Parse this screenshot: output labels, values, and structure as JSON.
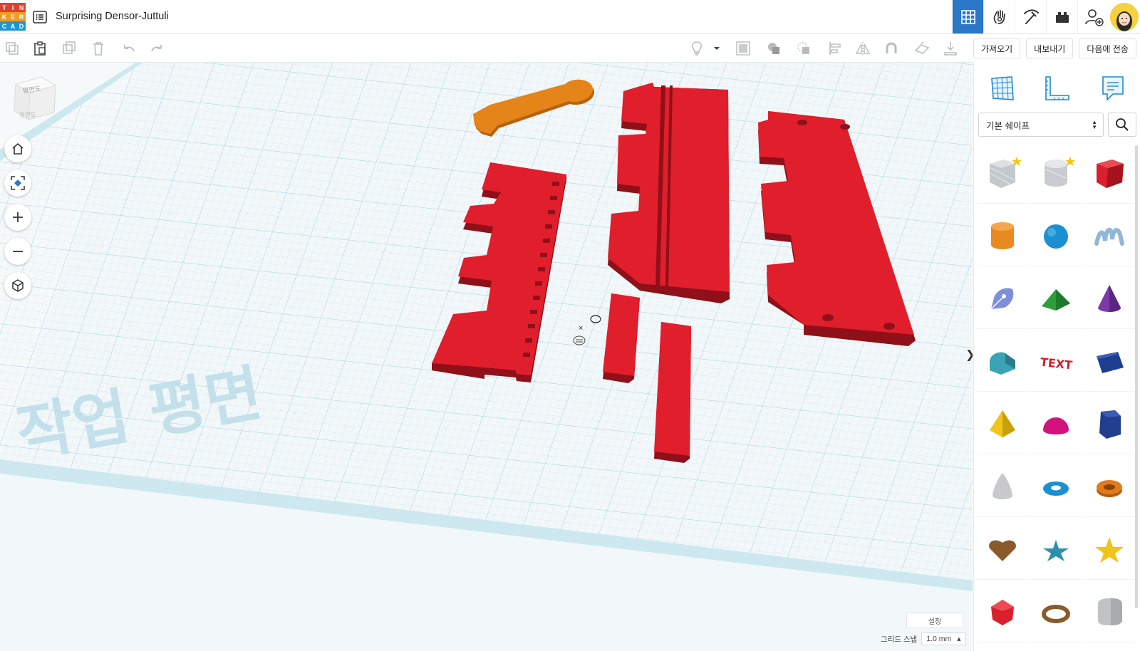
{
  "app": {
    "logo_letters": [
      "T",
      "I",
      "N",
      "K",
      "E",
      "R",
      "C",
      "A",
      "D"
    ],
    "logo_colors": [
      "#e1412b",
      "#e1412b",
      "#e1412b",
      "#f29b1f",
      "#f29b1f",
      "#f29b1f",
      "#1b96d6",
      "#1b96d6",
      "#1b96d6"
    ],
    "title": "Surprising Densor-Juttuli"
  },
  "topnav": {
    "items": [
      {
        "icon": "3d-grid-icon",
        "active": true
      },
      {
        "icon": "circuits-hand-icon",
        "active": false
      },
      {
        "icon": "pickaxe-icon",
        "active": false
      },
      {
        "icon": "brick-icon",
        "active": false
      },
      {
        "icon": "add-user-icon",
        "active": false
      }
    ]
  },
  "toolbar": {
    "left_icons": [
      "copy-icon",
      "paste-icon",
      "duplicate-icon",
      "delete-icon",
      "undo-icon",
      "redo-icon"
    ],
    "right_icons": [
      "light-bulb-icon",
      "chevron-down-icon",
      "group-icon",
      "solid-icon",
      "hole-icon",
      "align-icon",
      "mirror-icon",
      "magnet-icon",
      "workplane-icon",
      "ruler-drop-icon"
    ],
    "import_label": "가져오기",
    "export_label": "내보내기",
    "send_label": "다음에 전송"
  },
  "viewport": {
    "viewcube_top": "평면도",
    "viewcube_front": "정면도",
    "workplane_watermark": "작업 평면",
    "settings_label": "설정",
    "grid_snap_label": "그리드 스냅",
    "grid_snap_value": "1.0 mm",
    "collapse_glyph": "❯"
  },
  "panel": {
    "tabs": [
      "grid-panel-icon",
      "ruler-panel-icon",
      "notes-panel-icon"
    ],
    "category": "기본 쉐이프",
    "shapes": [
      {
        "name": "box-hole",
        "color": "#b9bec4"
      },
      {
        "name": "cylinder-hole",
        "color": "#c8ccd0"
      },
      {
        "name": "box",
        "color": "#d9202c"
      },
      {
        "name": "cylinder",
        "color": "#e98a20"
      },
      {
        "name": "sphere",
        "color": "#1b8fd1"
      },
      {
        "name": "scribble",
        "color": "#8fb8d6"
      },
      {
        "name": "shape-generator",
        "color": "#7c8fd8"
      },
      {
        "name": "roof",
        "color": "#2e9e3b"
      },
      {
        "name": "cone",
        "color": "#7d3aa6"
      },
      {
        "name": "round-roof",
        "color": "#3aa3b6"
      },
      {
        "name": "text",
        "color": "#c9202a"
      },
      {
        "name": "wedge",
        "color": "#1e3f91"
      },
      {
        "name": "pyramid",
        "color": "#f0c419"
      },
      {
        "name": "half-sphere",
        "color": "#d4127d"
      },
      {
        "name": "polygon",
        "color": "#213e8f"
      },
      {
        "name": "paraboloid",
        "color": "#c7c9cc"
      },
      {
        "name": "torus",
        "color": "#1b8fd1"
      },
      {
        "name": "tube",
        "color": "#e07a1a"
      },
      {
        "name": "heart",
        "color": "#8a5a2b"
      },
      {
        "name": "star",
        "color": "#2f8fb0"
      },
      {
        "name": "star-yellow",
        "color": "#f0c419"
      },
      {
        "name": "icosahedron",
        "color": "#d9202c"
      },
      {
        "name": "ring",
        "color": "#8a5a2b"
      },
      {
        "name": "rounded-box",
        "color": "#c0c3c6"
      }
    ]
  },
  "colors": {
    "accent": "#2a78c7",
    "part_red": "#e11e2b",
    "part_red_side": "#8f1019",
    "part_orange": "#e58419",
    "grid_line": "#b9dce8"
  }
}
